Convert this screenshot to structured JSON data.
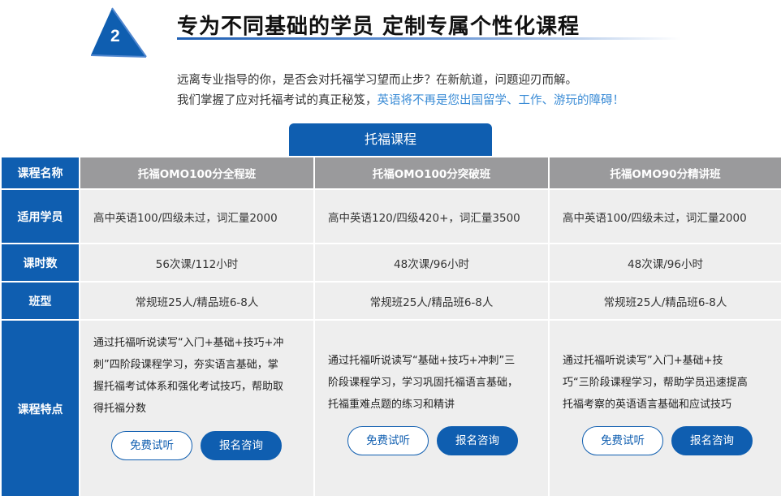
{
  "header": {
    "step_number": "2",
    "headline": "专为不同基础的学员 定制专属个性化课程",
    "intro_line1": "远离专业指导的你，是否会对托福学习望而止步？在新航道，问题迎刃而解。",
    "intro_line2_plain": "我们掌握了应对托福考试的真正秘笈，",
    "intro_line2_accent": "英语将不再是您出国留学、工作、游玩的障碍！"
  },
  "tab": {
    "label": "托福课程"
  },
  "table": {
    "row_headers": {
      "name": "课程名称",
      "audience": "适用学员",
      "hours": "课时数",
      "class_type": "班型",
      "features": "课程特点"
    },
    "courses": [
      {
        "name": "托福OMO100分全程班",
        "audience": "高中英语100/四级未过，词汇量2000",
        "hours": "56次课/112小时",
        "class_type": "常规班25人/精品班6-8人",
        "features": [
          "通过托福听说读写“入门+基础+技巧+冲",
          "刺”四阶段课程学习，夯实语言基础，掌",
          "握托福考试体系和强化考试技巧，帮助取",
          "得托福分数"
        ]
      },
      {
        "name": "托福OMO100分突破班",
        "audience": "高中英语120/四级420+，词汇量3500",
        "hours": "48次课/96小时",
        "class_type": "常规班25人/精品班6-8人",
        "features": [
          "通过托福听说读写“基础+技巧+冲刺”三",
          "阶段课程学习，学习巩固托福语言基础，",
          "托福重难点题的练习和精讲"
        ]
      },
      {
        "name": "托福OMO90分精讲班",
        "audience": "高中英语100/四级未过，词汇量2000",
        "hours": "48次课/96小时",
        "class_type": "常规班25人/精品班6-8人",
        "features": [
          "通过托福听说读写”入门+基础+技",
          "巧“三阶段课程学习，帮助学员迅速提高",
          "托福考察的英语语言基础和应试技巧"
        ]
      }
    ],
    "buttons": {
      "trial": "免费试听",
      "consult": "报名咨询"
    }
  },
  "colors": {
    "brand_blue": "#0f5eb0",
    "header_gray": "#9a9a9c",
    "cell_bg": "#eeeeee",
    "accent_text": "#3b8cd6"
  }
}
